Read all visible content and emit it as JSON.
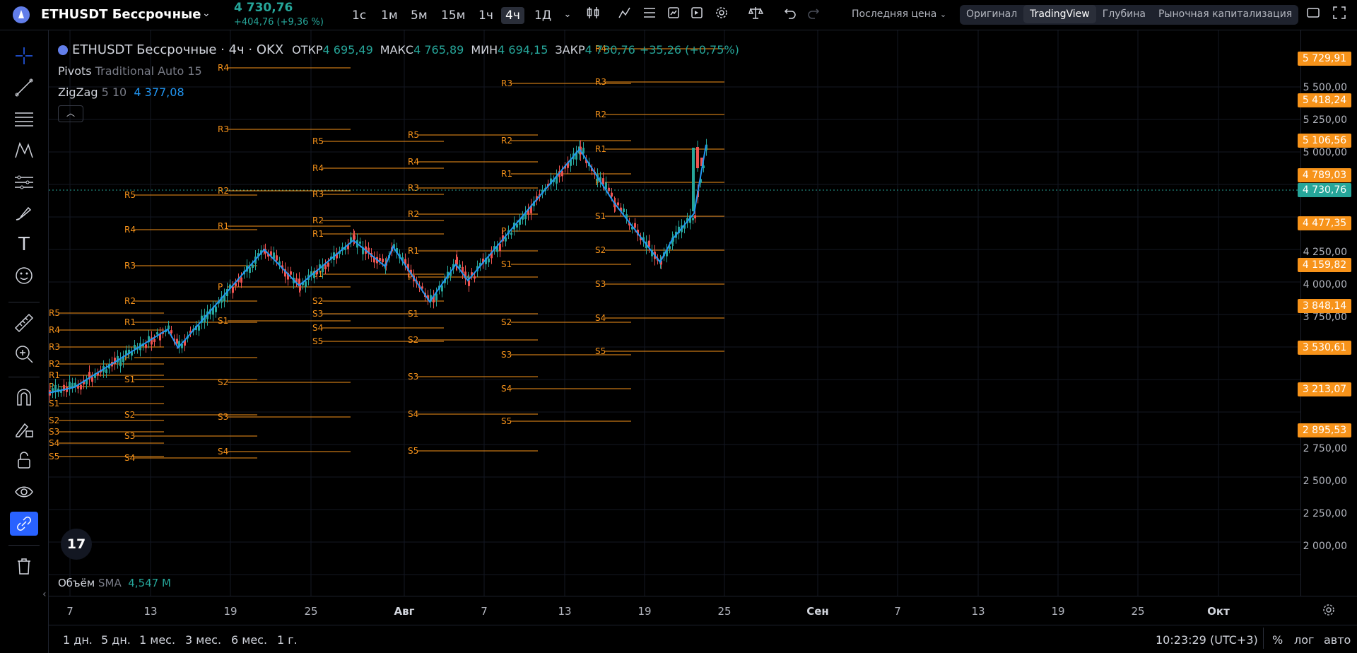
{
  "header": {
    "symbol": "ETHUSDT Бессрочные",
    "last_price": "4 730,76",
    "change": "+404,76 (+9,36 %)",
    "timeframes": [
      "1с",
      "1м",
      "5м",
      "15м",
      "1ч",
      "4ч",
      "1Д"
    ],
    "active_timeframe": "4ч",
    "price_source": "Последняя цена",
    "chart_types": [
      "Оригинал",
      "TradingView",
      "Глубина",
      "Рыночная капитализация"
    ],
    "active_chart_type": "TradingView"
  },
  "legend": {
    "title": "ETHUSDT Бессрочные · 4ч · OKX",
    "open_label": "ОТКР",
    "open": "4 695,49",
    "high_label": "МАКС",
    "high": "4 765,89",
    "low_label": "МИН",
    "low": "4 694,15",
    "close_label": "ЗАКР",
    "close": "4 730,76",
    "change": "+35,26 (+0,75%)",
    "pivots_name": "Pivots",
    "pivots_params": "Traditional Auto 15",
    "zigzag_name": "ZigZag",
    "zigzag_params": "5 10",
    "zigzag_value": "4 377,08",
    "volume_name": "Объём",
    "volume_ma": "SMA",
    "volume_value": "4,547 M"
  },
  "price_scale": {
    "labels": [
      "5 500,00",
      "5 250,00",
      "5 000,00",
      "4 250,00",
      "4 000,00",
      "3 750,00",
      "2 750,00",
      "2 500,00",
      "2 250,00",
      "2 000,00"
    ],
    "tags": [
      {
        "text": "5 729,91",
        "color": "#f7931a"
      },
      {
        "text": "5 418,24",
        "color": "#f7931a"
      },
      {
        "text": "5 106,56",
        "color": "#f7931a"
      },
      {
        "text": "4 789,03",
        "color": "#f7931a"
      },
      {
        "text": "4 730,76",
        "color": "#26a69a"
      },
      {
        "text": "4 477,35",
        "color": "#f7931a"
      },
      {
        "text": "4 159,82",
        "color": "#f7931a"
      },
      {
        "text": "3 848,14",
        "color": "#f7931a"
      },
      {
        "text": "3 530,61",
        "color": "#f7931a"
      },
      {
        "text": "3 213,07",
        "color": "#f7931a"
      },
      {
        "text": "2 895,53",
        "color": "#f7931a"
      }
    ]
  },
  "time_axis": {
    "labels": [
      "7",
      "13",
      "19",
      "25",
      "Авг",
      "7",
      "13",
      "19",
      "25",
      "Сен",
      "7",
      "13",
      "19",
      "25",
      "Окт"
    ]
  },
  "bottom": {
    "ranges": [
      "1 дн.",
      "5 дн.",
      "1 мес.",
      "3 мес.",
      "6 мес.",
      "1 г."
    ],
    "clock": "10:23:29 (UTC+3)",
    "percent": "%",
    "log": "лог",
    "auto": "авто"
  },
  "pivot_labels": {
    "r5": "R5",
    "r4": "R4",
    "r3": "R3",
    "r2": "R2",
    "r1": "R1",
    "p": "P",
    "s1": "S1",
    "s2": "S2",
    "s3": "S3",
    "s4": "S4",
    "s5": "S5"
  },
  "tv_logo": "17",
  "colors": {
    "pivot": "#f7931a",
    "zigzag": "#2196f3",
    "up": "#26a69a",
    "down": "#ef5350"
  }
}
